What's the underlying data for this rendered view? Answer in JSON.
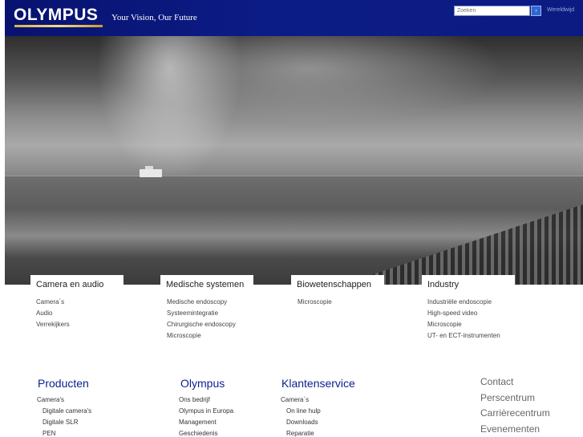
{
  "header": {
    "logo": "OLYMPUS",
    "tagline": "Your Vision, Our Future",
    "search_placeholder": "Zoeken",
    "search_button": "›",
    "worldwide": "Wereldwijd"
  },
  "categories": [
    {
      "title": "Camera en audio",
      "items": [
        "Camera´s",
        "Audio",
        "Verrekijkers"
      ]
    },
    {
      "title": "Medische systemen",
      "items": [
        "Medische endoscopy",
        "Systeemintegratie",
        "Chirurgische endoscopy",
        "Microscopie"
      ]
    },
    {
      "title": "Biowetenschappen",
      "items": [
        "Microscopie"
      ]
    },
    {
      "title": "Industry",
      "items": [
        "Industriële endoscopie",
        "High-speed video",
        "Microscopie",
        "UT- en ECT-instrumenten"
      ]
    }
  ],
  "footer": {
    "producten": {
      "title": "Producten",
      "items": [
        "Camera's",
        "Digitale camera's",
        "Digitale SLR",
        "PEN"
      ]
    },
    "olympus": {
      "title": "Olympus",
      "items": [
        "Ons bedrijf",
        "Olympus in Europa",
        "Management",
        "Geschiedenis"
      ]
    },
    "klantenservice": {
      "title": "Klantenservice",
      "items": [
        "Camera´s",
        "On line hulp",
        "Downloads",
        "Reparatie"
      ]
    },
    "right_links": [
      "Contact",
      "Perscentrum",
      "Carrièrecentrum",
      "Evenementen"
    ]
  },
  "colors": {
    "header_bg": "#0b1b82",
    "heading_blue": "#0a1f8f",
    "logo_gold": "#e0bd5a"
  }
}
